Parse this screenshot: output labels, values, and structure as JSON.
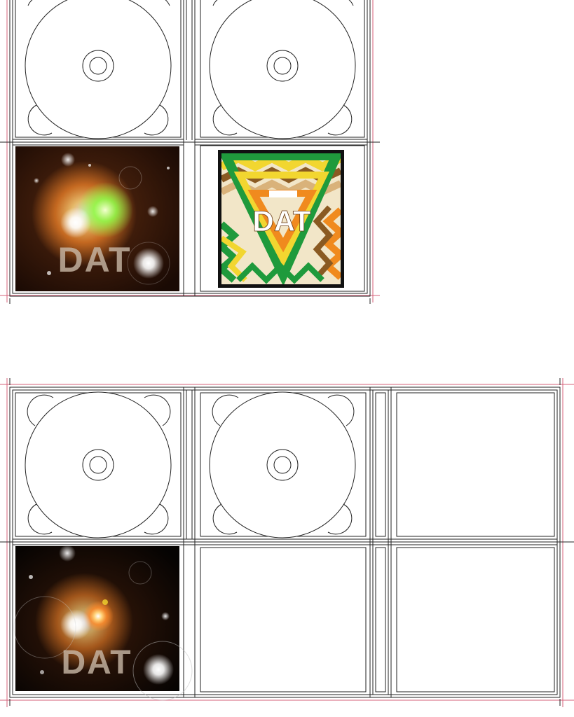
{
  "artwork": {
    "brand_text": "DAT"
  },
  "colors": {
    "line": "#222222",
    "trim": "#d4607a",
    "paper": "#ffffff",
    "cosmic_bg": "#2a1408",
    "cosmic_bg_dark": "#0c0604",
    "flare_orange": "#ff8a2a",
    "flare_green": "#8cff4a",
    "zig_green": "#1f9a3c",
    "zig_yellow": "#f2d630",
    "zig_orange": "#f08a1e",
    "zig_brown": "#8a5a22",
    "zig_tan": "#d9b27a"
  },
  "templates": [
    {
      "name": "top-template",
      "panels": [
        "disc-tray",
        "disc-tray",
        "cosmic-art",
        "zigzag-art"
      ]
    },
    {
      "name": "bottom-template",
      "panels": [
        "disc-tray",
        "disc-tray",
        "blank",
        "cosmic-art",
        "blank",
        "blank"
      ]
    }
  ]
}
